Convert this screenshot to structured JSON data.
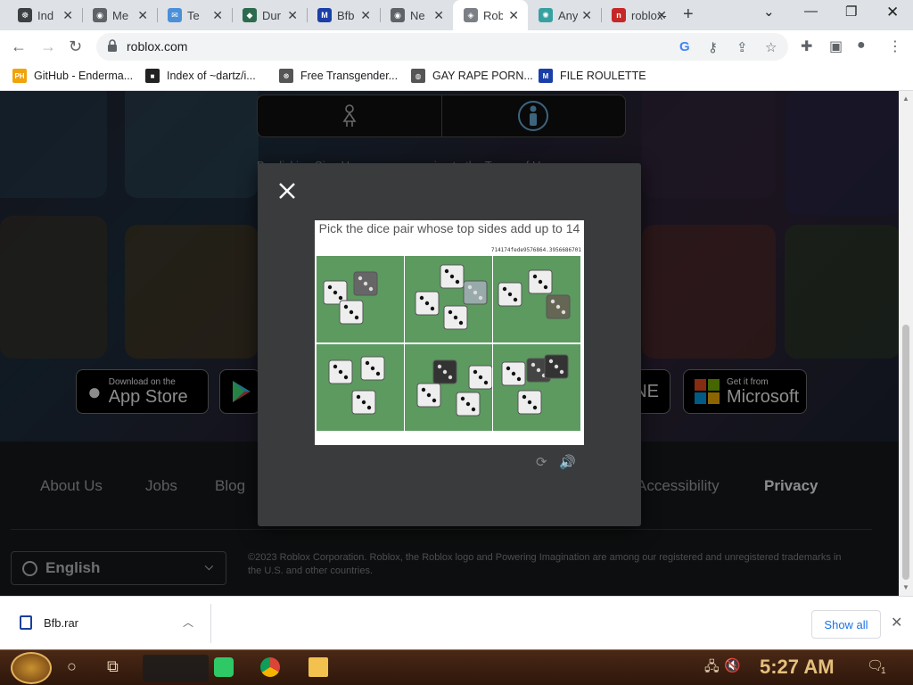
{
  "browser": {
    "tabs": [
      {
        "title": "Ind",
        "fav": "#3c4043",
        "icon": "github-icon",
        "glyph": "☸"
      },
      {
        "title": "Me",
        "fav": "#5f6368",
        "icon": "chrome-icon",
        "glyph": "◉"
      },
      {
        "title": "Te",
        "fav": "#4a90d9",
        "icon": "mail-icon",
        "glyph": "✉"
      },
      {
        "title": "Dur",
        "fav": "#2d6b4f",
        "icon": "duo-icon",
        "glyph": "◆"
      },
      {
        "title": "Bfb",
        "fav": "#1a3fa8",
        "icon": "mft-icon",
        "glyph": "M"
      },
      {
        "title": "Ne",
        "fav": "#5f6368",
        "icon": "chrome-icon",
        "glyph": "◉"
      },
      {
        "title": "Rob",
        "fav": "#7b7f86",
        "icon": "roblox-icon",
        "glyph": "◈"
      },
      {
        "title": "Any",
        "fav": "#37a0a0",
        "icon": "gear-icon",
        "glyph": "✺"
      },
      {
        "title": "roblox-",
        "fav": "#c62828",
        "icon": "n-icon",
        "glyph": "n"
      }
    ],
    "active_tab": 6,
    "new_tab": "+",
    "url": "roblox.com",
    "bookmarks": [
      {
        "label": "GitHub - Enderma...",
        "icon": "ph-icon",
        "glyph": "PH",
        "color": "#f0a30a"
      },
      {
        "label": "Index of ~dartz/i...",
        "icon": "apple-icon",
        "glyph": "■",
        "color": "#222222"
      },
      {
        "label": "Free Transgender...",
        "icon": "github-icon",
        "glyph": "☸",
        "color": "#555555"
      },
      {
        "label": "GAY RAPE PORN...",
        "icon": "globe-icon",
        "glyph": "◍",
        "color": "#555555"
      },
      {
        "label": "FILE ROULETTE",
        "icon": "mft-icon",
        "glyph": "M",
        "color": "#1a3fa8"
      }
    ]
  },
  "page": {
    "agree_text": "By clicking Sign Up, you are agreeing to the Terms of Use",
    "stores": [
      {
        "small": "Download on the",
        "big": "App Store",
        "icon": "apple-icon"
      },
      {
        "small": "",
        "big": "",
        "icon": "google-play-icon"
      },
      {
        "small": "",
        "big": "NE",
        "icon": "partial-icon"
      },
      {
        "small": "Get it from",
        "big": "Microsoft",
        "icon": "microsoft-icon"
      }
    ],
    "footer_links": [
      "About Us",
      "Jobs",
      "Blog",
      "Accessibility",
      "Privacy"
    ],
    "language": "English",
    "copyright": "©2023 Roblox Corporation. Roblox, the Roblox logo and Powering Imagination are among our registered and unregistered trademarks in the U.S. and other countries."
  },
  "captcha": {
    "prompt": "Pick the dice pair whose top sides add up to 14",
    "code": "714174fede9576864.3956686701",
    "cells": [
      {
        "label": "dice-image-1"
      },
      {
        "label": "dice-image-2"
      },
      {
        "label": "dice-image-3"
      },
      {
        "label": "dice-image-4"
      },
      {
        "label": "dice-image-5"
      },
      {
        "label": "dice-image-6"
      }
    ]
  },
  "download_bar": {
    "file": "Bfb.rar",
    "show_all": "Show all"
  },
  "taskbar": {
    "time": "5:27 AM",
    "notification_count": "1"
  },
  "colors": {
    "page_bg": "#191b1d",
    "modal_bg": "#393b3d",
    "dice_green": "#5c9a60",
    "link_blue": "#1a73e8"
  }
}
